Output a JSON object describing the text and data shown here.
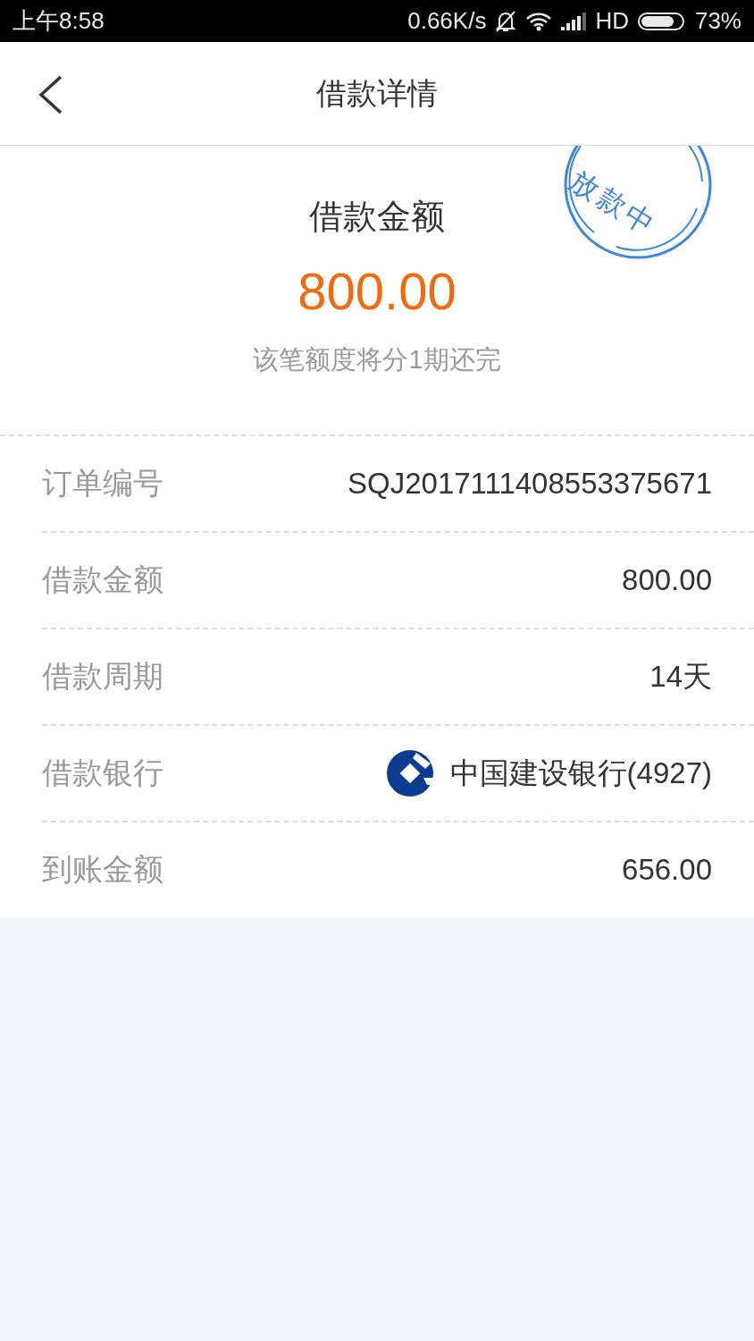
{
  "status_bar": {
    "time": "上午8:58",
    "speed": "0.66K/s",
    "network": "HD",
    "battery": "73%"
  },
  "header": {
    "title": "借款详情"
  },
  "summary": {
    "label": "借款金额",
    "amount": "800.00",
    "note": "该笔额度将分1期还完",
    "stamp": "放款中"
  },
  "rows": [
    {
      "kind": "text",
      "label": "订单编号",
      "value": "SQJ2017111408553375671"
    },
    {
      "kind": "text",
      "label": "借款金额",
      "value": "800.00"
    },
    {
      "kind": "text",
      "label": "借款周期",
      "value": "14天"
    },
    {
      "kind": "bank",
      "label": "借款银行",
      "value": "中国建设银行(4927)"
    },
    {
      "kind": "text",
      "label": "到账金额",
      "value": "656.00"
    }
  ]
}
